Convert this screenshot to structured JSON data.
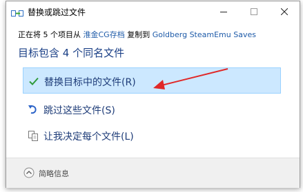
{
  "window": {
    "title": "替换或跳过文件",
    "icon": "file-transfer-icon"
  },
  "copy_info": {
    "prefix": "正在将 5 个项目从 ",
    "source": "淮金CG存档",
    "middle": " 复制到 ",
    "destination": "Goldberg SteamEmu Saves"
  },
  "heading": "目标包含 4 个同名文件",
  "options": [
    {
      "label": "替换目标中的文件(R)",
      "icon": "checkmark-icon",
      "selected": true
    },
    {
      "label": "跳过这些文件(S)",
      "icon": "skip-icon",
      "selected": false
    },
    {
      "label": "让我决定每个文件(L)",
      "icon": "decide-each-file-icon",
      "selected": false
    }
  ],
  "footer": {
    "details_label": "简略信息",
    "icon": "chevron-up-circle-icon"
  },
  "colors": {
    "selected_bg": "#cce8ff",
    "option_text": "#1e3c78",
    "link": "#1d5aa8",
    "annotation_arrow": "#e02828"
  }
}
